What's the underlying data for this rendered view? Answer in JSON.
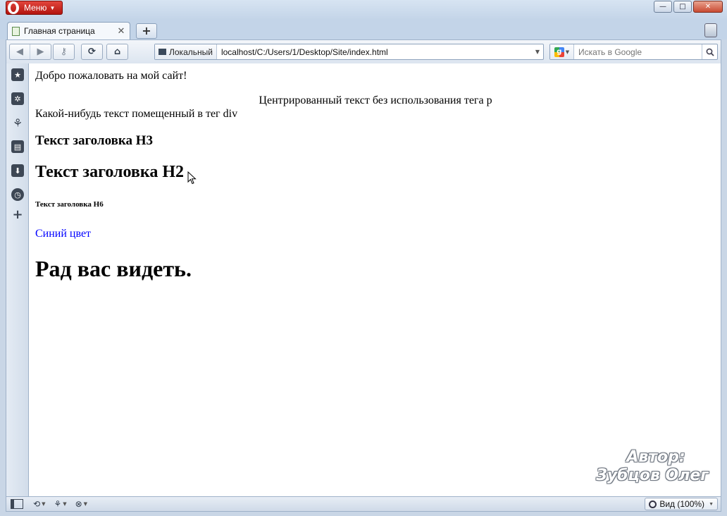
{
  "window": {
    "menu_label": "Меню",
    "controls": {
      "minimize": "—",
      "maximize": "□",
      "close": "✕"
    }
  },
  "tabs": {
    "active_title": "Главная страница",
    "close_glyph": "✕",
    "new_tab_glyph": "+"
  },
  "toolbar": {
    "security_label": "Локальный",
    "url": "localhost/C:/Users/1/Desktop/Site/index.html",
    "search_placeholder": "Искать в Google",
    "search_engine_letter": "g"
  },
  "page": {
    "welcome": "Добро пожаловать на мой сайт!",
    "centered": "Центрированный текст без использования тега p",
    "div_text": "Какой-нибудь текст помещенный в тег div",
    "h3": "Текст заголовка H3",
    "h2": "Текст заголовка H2",
    "h6": "Текст заголовка H6",
    "blue_text": "Синий цвет",
    "h1": "Рад вас видеть."
  },
  "watermark": {
    "line1": "Автор:",
    "line2": "Зубцов Олег"
  },
  "statusbar": {
    "zoom_label": "Вид (100%)"
  },
  "colors": {
    "link_blue": "#0000ff",
    "menu_red": "#c8201a"
  }
}
